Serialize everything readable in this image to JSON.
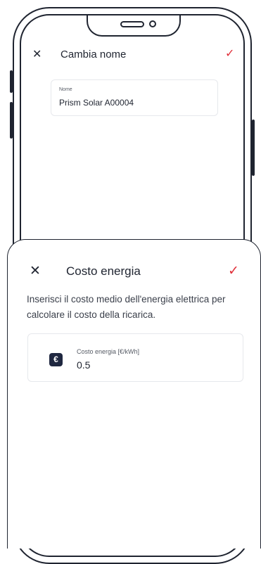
{
  "background_screen": {
    "header": {
      "close_icon": "close-icon",
      "title": "Cambia nome",
      "confirm_icon": "check-icon"
    },
    "name_field": {
      "label": "Nome",
      "value": "Prism Solar A00004"
    }
  },
  "sheet": {
    "header": {
      "close_icon": "close-icon",
      "title": "Costo energia",
      "confirm_icon": "check-icon"
    },
    "description": "Inserisci il costo medio dell'energia elettrica per calcolare il costo della ricarica.",
    "energy_field": {
      "icon": "euro-icon",
      "icon_glyph": "€",
      "label": "Costo energia [€/kWh]",
      "value": "0.5"
    }
  },
  "colors": {
    "accent": "#e0303a",
    "text": "#1f2430",
    "badge": "#1f2740",
    "border": "#e6e8ec"
  }
}
